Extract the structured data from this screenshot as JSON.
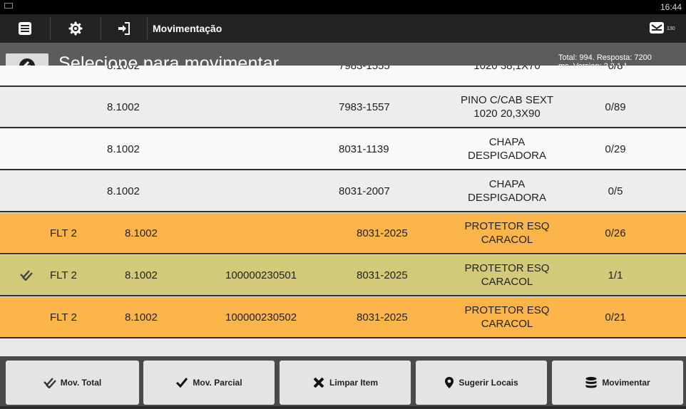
{
  "status_bar": {
    "time": "16:44"
  },
  "action_bar": {
    "title": "Movimentação",
    "icons": [
      "menu-icon",
      "gear-icon",
      "sign-in-icon",
      "message-icon"
    ],
    "message_count": "130"
  },
  "header": {
    "title": "Selecione para movimentar",
    "stats_line1": "Total: 994. Resposta: 7200",
    "stats_line2": "ms. Version: 2.2.1.1"
  },
  "rows": [
    {
      "selected": false,
      "loc": "",
      "wh": "8.1002",
      "lot": "",
      "code": "7983-1555",
      "desc1": "",
      "desc2": "1020 38,1X70",
      "qty": "0/8",
      "color": "white"
    },
    {
      "selected": false,
      "loc": "",
      "wh": "8.1002",
      "lot": "",
      "code": "7983-1557",
      "desc1": "PINO C/CAB SEXT",
      "desc2": "1020 20,3X90",
      "qty": "0/89",
      "color": "gray"
    },
    {
      "selected": false,
      "loc": "",
      "wh": "8.1002",
      "lot": "",
      "code": "8031-1139",
      "desc1": "CHAPA",
      "desc2": "DESPIGADORA",
      "qty": "0/29",
      "color": "white"
    },
    {
      "selected": false,
      "loc": "",
      "wh": "8.1002",
      "lot": "",
      "code": "8031-2007",
      "desc1": "CHAPA",
      "desc2": "DESPIGADORA",
      "qty": "0/5",
      "color": "gray"
    },
    {
      "selected": false,
      "loc": "FLT 2",
      "wh": "8.1002",
      "lot": "",
      "code": "8031-2025",
      "desc1": "PROTETOR ESQ",
      "desc2": "CARACOL",
      "qty": "0/26",
      "color": "orange"
    },
    {
      "selected": true,
      "loc": "FLT 2",
      "wh": "8.1002",
      "lot": "100000230501",
      "code": "8031-2025",
      "desc1": "PROTETOR ESQ",
      "desc2": "CARACOL",
      "qty": "1/1",
      "color": "olive"
    },
    {
      "selected": false,
      "loc": "FLT 2",
      "wh": "8.1002",
      "lot": "100000230502",
      "code": "8031-2025",
      "desc1": "PROTETOR ESQ",
      "desc2": "CARACOL",
      "qty": "0/21",
      "color": "orange"
    }
  ],
  "bottom_buttons": [
    {
      "label": "Mov. Total",
      "icon": "double-check-icon"
    },
    {
      "label": "Mov. Parcial",
      "icon": "check-icon"
    },
    {
      "label": "Limpar Item",
      "icon": "x-icon"
    },
    {
      "label": "Sugerir Locais",
      "icon": "map-marker-icon"
    },
    {
      "label": "Movimentar",
      "icon": "database-icon"
    }
  ],
  "colors": {
    "row_white": "#fafafa",
    "row_gray": "#ededed",
    "row_orange": "#fbb54a",
    "row_selected": "#d2ca78",
    "header_bg": "#5c5c5c",
    "action_bar_bg": "#232323"
  }
}
